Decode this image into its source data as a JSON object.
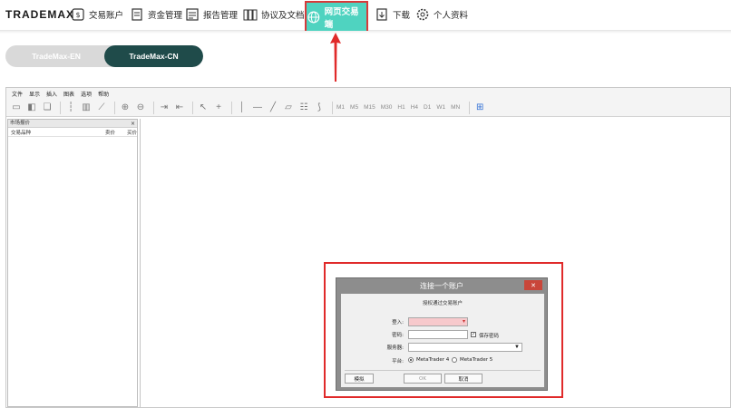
{
  "logo": {
    "text": "TRADEMAX"
  },
  "nav": {
    "items": [
      {
        "label": "交易账户",
        "icon": "account-icon"
      },
      {
        "label": "资金管理",
        "icon": "funds-icon"
      },
      {
        "label": "报告管理",
        "icon": "report-icon"
      },
      {
        "label": "协议及文档",
        "icon": "documents-icon"
      },
      {
        "label": "网页交易端",
        "icon": "globe-icon",
        "active": true
      },
      {
        "label": "下载",
        "icon": "download-icon"
      },
      {
        "label": "个人资料",
        "icon": "gear-icon"
      }
    ]
  },
  "server_tabs": {
    "en": "TradeMax-EN",
    "cn": "TradeMax-CN",
    "active": "cn"
  },
  "terminal": {
    "menu": [
      "文件",
      "显示",
      "插入",
      "图表",
      "选项",
      "帮助"
    ],
    "timeframes": [
      "M1",
      "M5",
      "M15",
      "M30",
      "H1",
      "H4",
      "D1",
      "W1",
      "MN"
    ],
    "market_watch": {
      "title": "市场报价",
      "close": "×",
      "columns": [
        "交易品种",
        "卖价",
        "买价"
      ]
    }
  },
  "dialog": {
    "title": "连接一个账户",
    "close": "✕",
    "subtitle": "授权通过交易账户",
    "login_label": "登入:",
    "password_label": "密码:",
    "save_password": "保存密码",
    "server_label": "服务器:",
    "platform_label": "平台:",
    "platform_mt4": "MetaTrader 4",
    "platform_mt5": "MetaTrader 5",
    "demo_button": "模拟",
    "ok_button": "OK",
    "cancel_button": "取消",
    "accent_color": "#4fd3c0",
    "highlight_color": "#e02a2a"
  }
}
